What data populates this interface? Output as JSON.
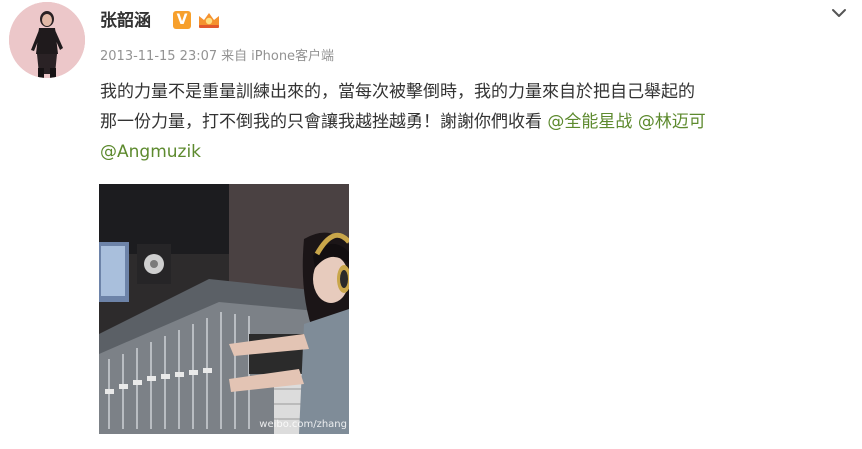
{
  "post": {
    "author_name": "张韶涵",
    "vip_badge": "V",
    "timestamp": "2013-11-15 23:07",
    "source_prefix": "来自",
    "source_app": "iPhone客户端",
    "text_line1": "我的力量不是重量訓練出來的，當每次被擊倒時，我的力量來自於把自己舉起的",
    "text_line2_before": "那一份力量，打不倒我的只會讓我越挫越勇！謝謝你們收看 ",
    "mention1": "@全能星战",
    "mention2": "@林迈可",
    "mention3": "@Angmuzik",
    "image_watermark": "weibo.com/zhang"
  },
  "icons": {
    "expand": "chevron-down-icon",
    "vip": "verified-v-icon",
    "level": "member-level-icon"
  },
  "colors": {
    "mention": "#5d8a2e",
    "meta": "#939393",
    "vip": "#f7a02c"
  }
}
